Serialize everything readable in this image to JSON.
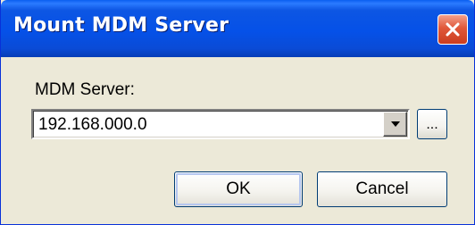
{
  "dialog": {
    "title": "Mount MDM Server",
    "close_icon": "close-icon",
    "server_label": "MDM Server:",
    "server_value": "192.168.000.0",
    "dropdown_icon": "chevron-down-icon",
    "browse_label": "...",
    "ok_label": "OK",
    "cancel_label": "Cancel"
  },
  "colors": {
    "titlebar": "#0551e8",
    "close_button": "#e0583a",
    "body_background": "#ece9d8"
  }
}
